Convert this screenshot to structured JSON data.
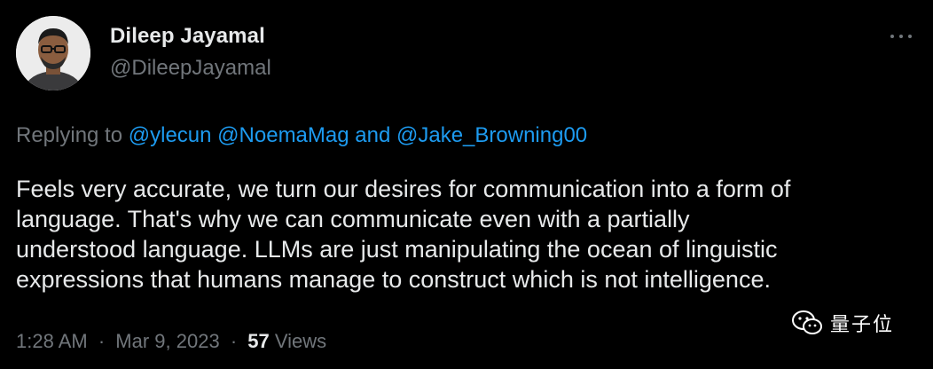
{
  "author": {
    "display_name": "Dileep Jayamal",
    "handle": "@DileepJayamal"
  },
  "more_menu": {
    "icon": "more-horizontal-icon"
  },
  "reply_context": {
    "prefix": "Replying to",
    "mentions": [
      "@ylecun",
      "@NoemaMag",
      "@Jake_Browning00"
    ],
    "conjunction": "and"
  },
  "tweet": {
    "lines": [
      "Feels very accurate, we turn our desires for communication into a form of",
      "language. That's why we can communicate even with a partially",
      "understood language. LLMs are just manipulating the ocean of linguistic",
      "expressions that humans manage to construct which is not intelligence."
    ]
  },
  "meta": {
    "time": "1:28 AM",
    "separator": "·",
    "date": "Mar 9, 2023",
    "views_count": "57",
    "views_label": "Views"
  },
  "watermark": {
    "icon": "wechat-icon",
    "text": "量子位"
  },
  "colors": {
    "background": "#000000",
    "primary_text": "#e7e9ea",
    "secondary_text": "#71767b",
    "link": "#1d9bf0"
  }
}
